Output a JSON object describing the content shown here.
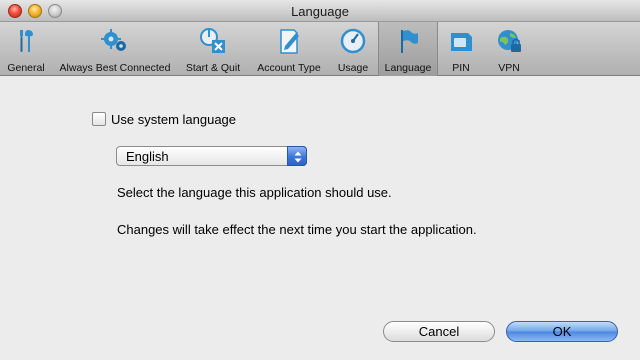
{
  "window": {
    "title": "Language"
  },
  "toolbar": {
    "items": [
      {
        "label": "General",
        "icon": "tools-icon"
      },
      {
        "label": "Always Best Connected",
        "icon": "gears-icon"
      },
      {
        "label": "Start & Quit",
        "icon": "start-quit-icon"
      },
      {
        "label": "Account Type",
        "icon": "account-type-icon"
      },
      {
        "label": "Usage",
        "icon": "usage-gauge-icon"
      },
      {
        "label": "Language",
        "icon": "flag-icon",
        "selected": true
      },
      {
        "label": "PIN",
        "icon": "sim-card-icon"
      },
      {
        "label": "VPN",
        "icon": "vpn-globe-icon"
      }
    ]
  },
  "content": {
    "use_system_language": {
      "label": "Use system language",
      "checked": false
    },
    "language_select": {
      "value": "English"
    },
    "info_line_1": "Select the language this application should use.",
    "info_line_2": "Changes will take effect the next time you start the application."
  },
  "buttons": {
    "cancel": "Cancel",
    "ok": "OK"
  },
  "colors": {
    "accent_blue": "#3c77d6",
    "window_bg": "#ececec",
    "toolbar_bg": "#c4c4c4"
  }
}
